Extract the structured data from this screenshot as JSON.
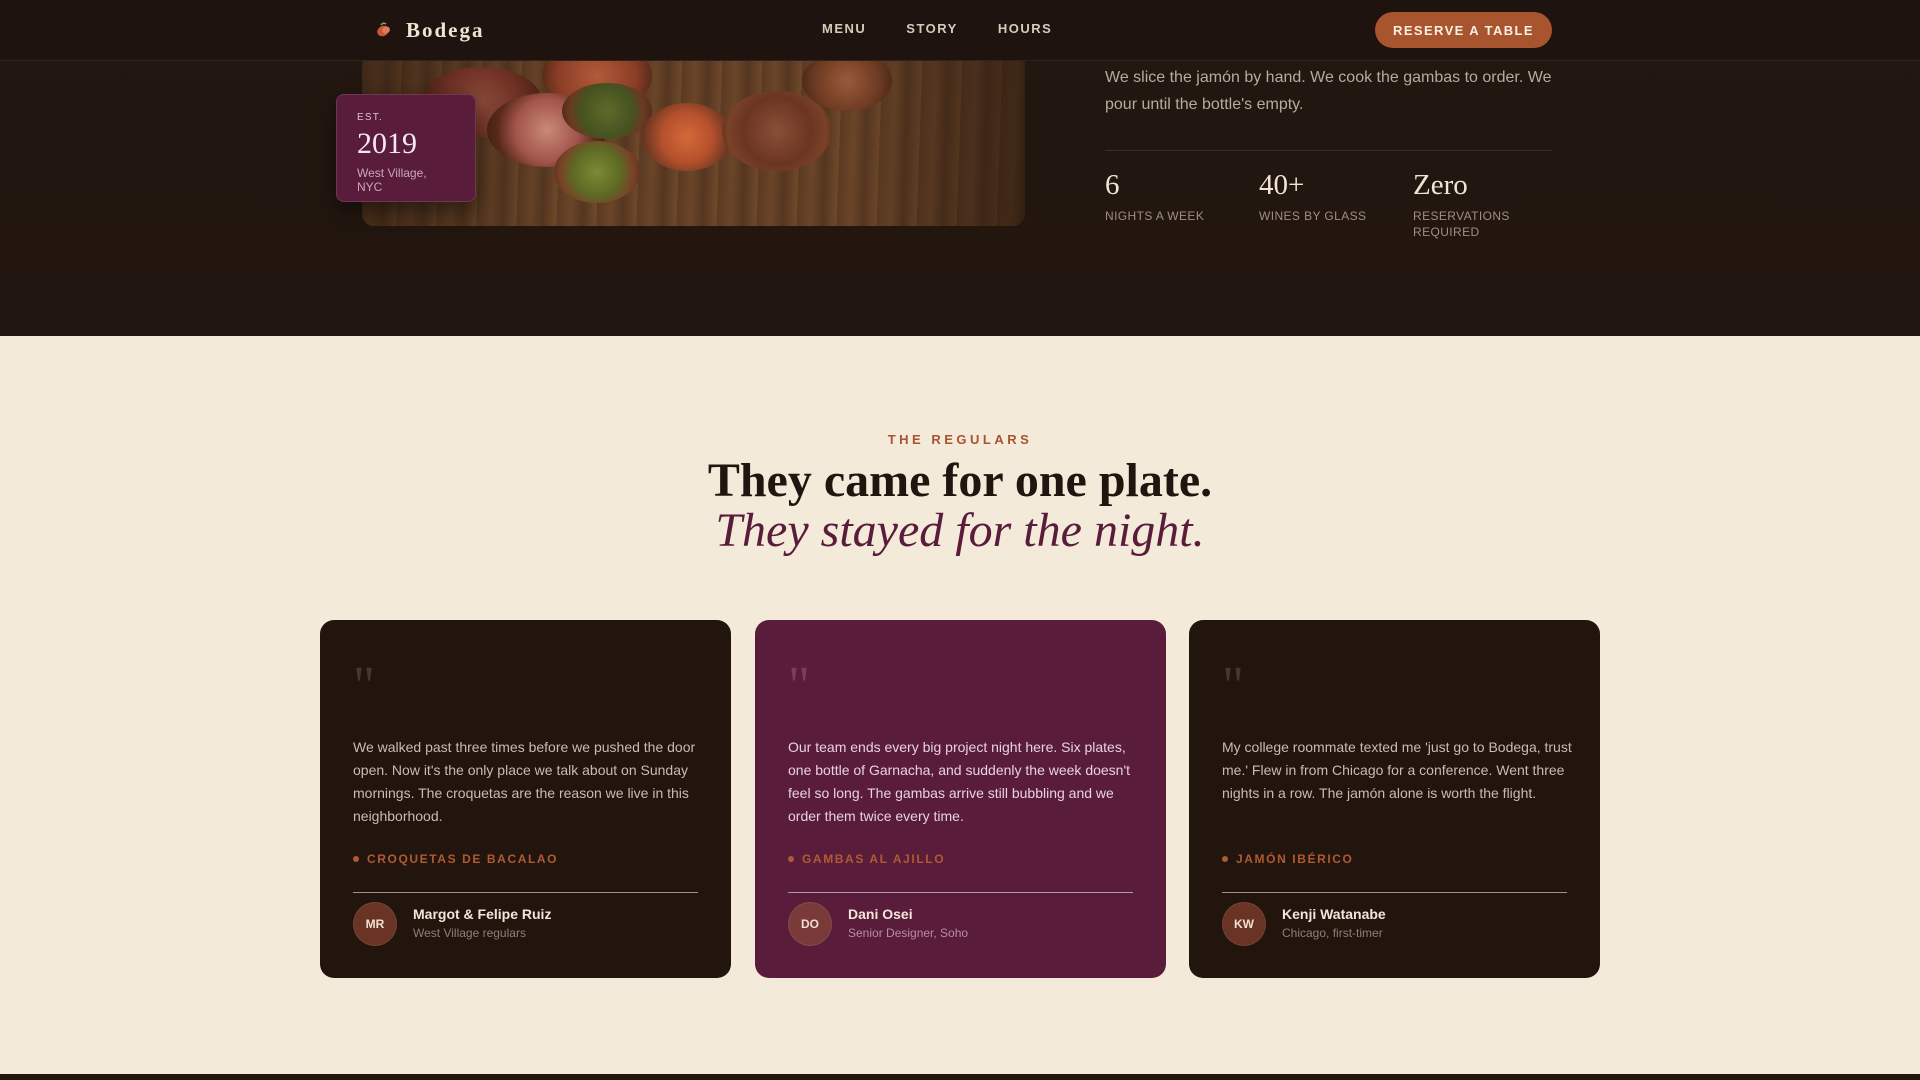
{
  "nav": {
    "brand": "Bodega",
    "links": [
      "MENU",
      "STORY",
      "HOURS"
    ],
    "cta": "RESERVE A TABLE"
  },
  "hero": {
    "est_label": "EST.",
    "est_year": "2019",
    "est_location": "West Village, NYC",
    "intro": "We slice the jamón by hand. We cook the gambas to order. We pour until the bottle's empty.",
    "stats": [
      {
        "value": "6",
        "label": "NIGHTS A WEEK"
      },
      {
        "value": "40+",
        "label": "WINES BY GLASS"
      },
      {
        "value": "Zero",
        "label": "RESERVATIONS REQUIRED"
      }
    ]
  },
  "testimonials": {
    "eyebrow": "THE REGULARS",
    "title": "They came for one plate.",
    "subtitle": "They stayed for the night.",
    "quote_mark": "\"",
    "cards": [
      {
        "quote": "We walked past three times before we pushed the door open. Now it's the only place we talk about on Sunday mornings. The croquetas are the reason we live in this neighborhood.",
        "dish": "CROQUETAS DE BACALAO",
        "initials": "MR",
        "name": "Margot & Felipe Ruiz",
        "role": "West Village regulars"
      },
      {
        "quote": "Our team ends every big project night here. Six plates, one bottle of Garnacha, and suddenly the week doesn't feel so long. The gambas arrive still bubbling and we order them twice every time.",
        "dish": "GAMBAS AL AJILLO",
        "initials": "DO",
        "name": "Dani Osei",
        "role": "Senior Designer, Soho"
      },
      {
        "quote": "My college roommate texted me 'just go to Bodega, trust me.' Flew in from Chicago for a conference. Went three nights in a row. The jamón alone is worth the flight.",
        "dish": "JAMÓN IBÉRICO",
        "initials": "KW",
        "name": "Kenji Watanabe",
        "role": "Chicago, first-timer"
      }
    ]
  },
  "colors": {
    "espresso": "#21150e",
    "plum": "#5a1c3b",
    "terracotta": "#a8542f",
    "cream": "#f3eada"
  },
  "icons": {
    "brand": "pepper-logo-icon",
    "quote": "quote-icon",
    "dish_marker": "dot-icon"
  }
}
